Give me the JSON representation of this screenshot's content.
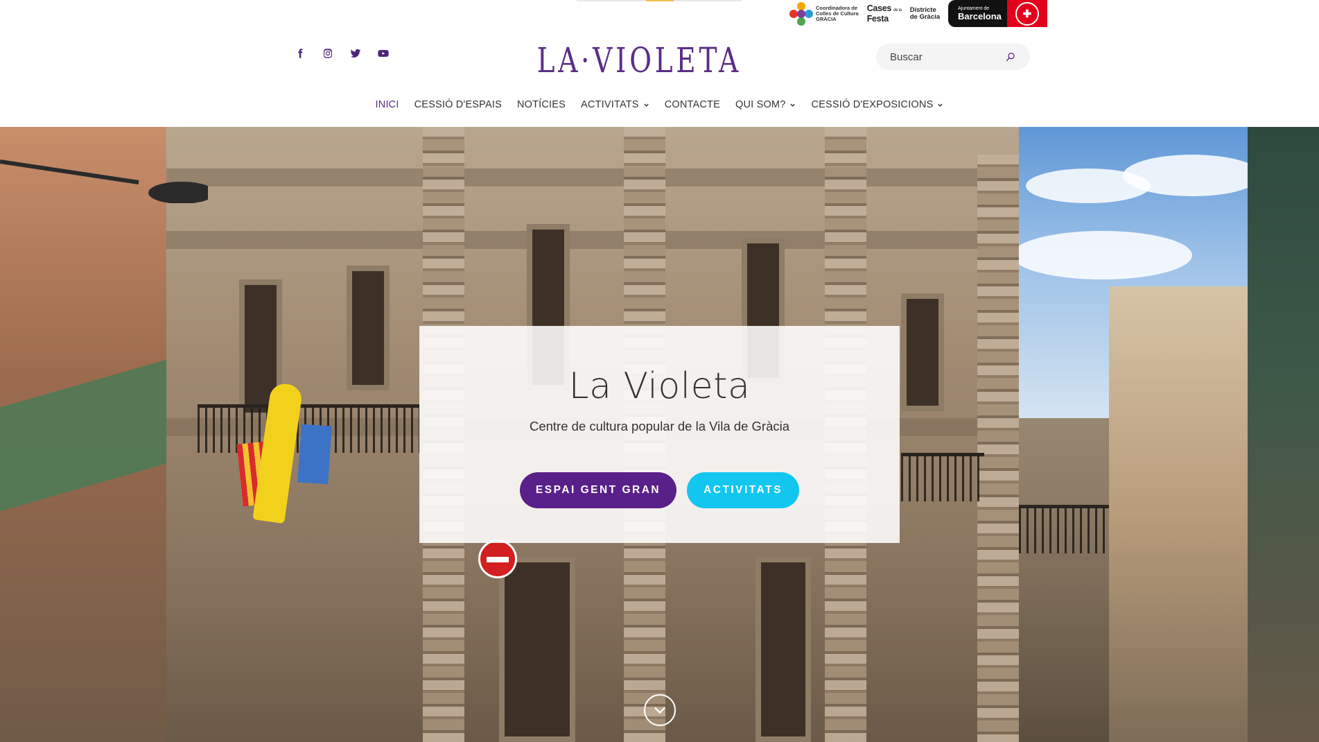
{
  "partners": {
    "coordinadora_text": "Coordinadora de\nColles de Cultura\nGRÀCIA",
    "cases_text": "Cases",
    "cases_small": "de la",
    "festa_text": "Festa",
    "districte_text": "Districte\nde Gràcia",
    "ajuntament_small": "Ajuntament de",
    "ajuntament_big": "Barcelona"
  },
  "social": [
    {
      "name": "facebook-icon"
    },
    {
      "name": "instagram-icon"
    },
    {
      "name": "twitter-icon"
    },
    {
      "name": "youtube-icon"
    }
  ],
  "brand": {
    "logo_text": "LA·VIOLETA"
  },
  "search": {
    "placeholder": "Buscar"
  },
  "nav": {
    "items": [
      {
        "label": "Inici",
        "active": true,
        "dropdown": false
      },
      {
        "label": "Cessió d'espais",
        "active": false,
        "dropdown": false
      },
      {
        "label": "Notícies",
        "active": false,
        "dropdown": false
      },
      {
        "label": "Activitats",
        "active": false,
        "dropdown": true
      },
      {
        "label": "Contacte",
        "active": false,
        "dropdown": false
      },
      {
        "label": "Qui som?",
        "active": false,
        "dropdown": true
      },
      {
        "label": "Cessió d'exposicions",
        "active": false,
        "dropdown": true
      }
    ]
  },
  "hero": {
    "title": "La Violeta",
    "subtitle": "Centre de cultura popular de la Vila de Gràcia",
    "primary_button": "Espai gent gran",
    "secondary_button": "Activitats"
  },
  "colors": {
    "brand_purple": "#5a2d86",
    "button_purple": "#5a2089",
    "button_cyan": "#12c6f0"
  }
}
